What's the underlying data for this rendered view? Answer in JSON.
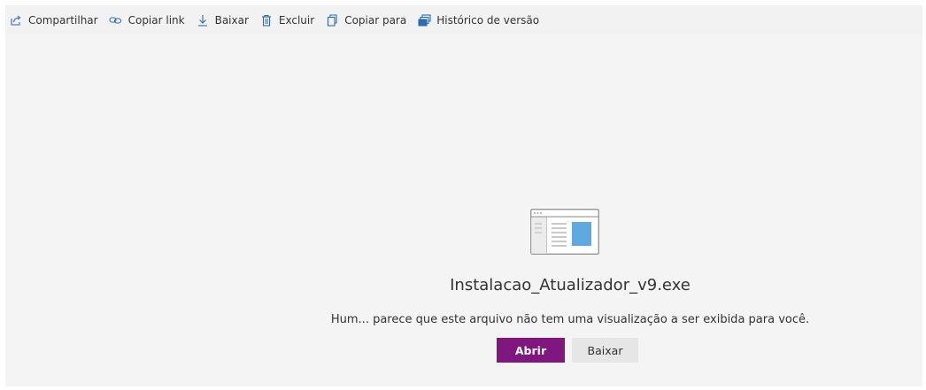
{
  "toolbar": {
    "items": [
      {
        "label": "Compartilhar",
        "icon": "share-icon"
      },
      {
        "label": "Copiar link",
        "icon": "link-icon"
      },
      {
        "label": "Baixar",
        "icon": "download-icon"
      },
      {
        "label": "Excluir",
        "icon": "trash-icon"
      },
      {
        "label": "Copiar para",
        "icon": "copy-icon"
      },
      {
        "label": "Histórico de versão",
        "icon": "version-history-icon"
      }
    ]
  },
  "preview": {
    "icon": "file-preview-icon",
    "filename": "Instalacao_Atualizador_v9.exe",
    "message": "Hum... parece que este arquivo não tem uma visualização a ser exibida para você.",
    "open_label": "Abrir",
    "download_label": "Baixar"
  },
  "colors": {
    "accent": "#80177f",
    "icon_blue": "#5fa8e0",
    "toolbar_icon": "#2b6cb0"
  }
}
